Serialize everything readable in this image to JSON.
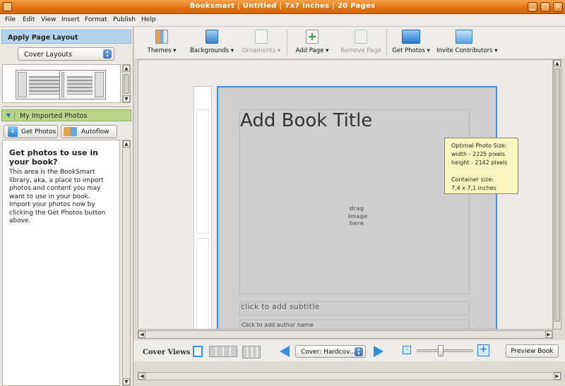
{
  "window": {
    "title": "Booksmart  |  Untitled  |  7x7 inches  |  20 Pages"
  },
  "menu": [
    "File",
    "Edit",
    "View",
    "Insert",
    "Format",
    "Publish",
    "Help"
  ],
  "left_panel": {
    "layout_header": "Apply Page Layout",
    "layout_select": "Cover Layouts",
    "photos_header": "My Imported Photos",
    "get_photos_label": "Get Photos",
    "autoflow_label": "Autoflow",
    "help_title": "Get photos to use in your book?",
    "help_body": "This area is the BookSmart library, aka, a place to import photos and content you may want to use in your book. Import your photos now by clicking the Get Photos button above."
  },
  "toolbar": {
    "themes": "Themes ▾",
    "backgrounds": "Backgrounds ▾",
    "ornaments": "Ornaments ▾",
    "add_page": "Add Page ▾",
    "remove_page": "Remove Page",
    "get_photos": "Get Photos ▾",
    "invite": "Invite Contributors ▾"
  },
  "cover": {
    "title": "Add Book Title",
    "drag_hint": "drag image here",
    "subtitle": "click to add subtitle",
    "author": "Click to add author name",
    "tooltip": {
      "line1": "Optimal Photo Size:",
      "line2": "width - 2225 pixels",
      "line3": "height - 2142 pixels",
      "line4": "Container size:",
      "line5": "7,4 x 7,1 inches"
    }
  },
  "bottom": {
    "cover_views": "Cover Views",
    "cover_select": "Cover: Hardcov...",
    "preview": "Preview Book"
  },
  "colors": {
    "titlebar": "#e07210",
    "accent_blue": "#3d8ee6",
    "photos_header": "#b9d68a",
    "layout_header": "#b4d3ec"
  }
}
